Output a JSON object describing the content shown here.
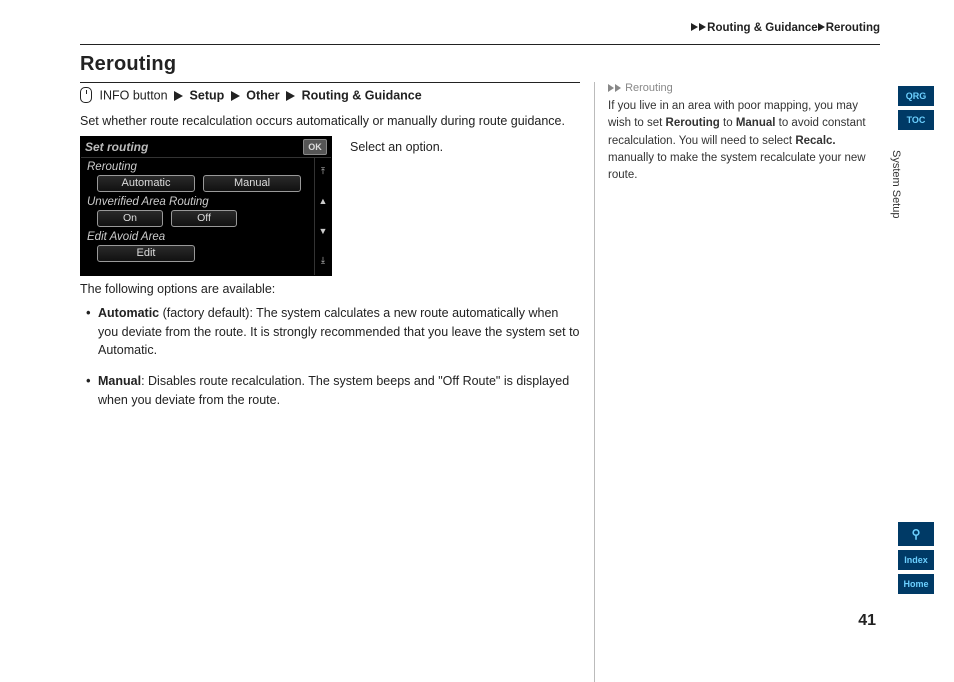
{
  "breadcrumb": {
    "seg1": "Routing & Guidance",
    "seg2": "Rerouting"
  },
  "title": "Rerouting",
  "navpath": {
    "prefix": "INFO button",
    "s1": "Setup",
    "s2": "Other",
    "s3": "Routing & Guidance"
  },
  "intro": "Set whether route recalculation occurs automatically or manually during route guidance.",
  "screen": {
    "title": "Set routing",
    "ok": "OK",
    "rerouting": "Rerouting",
    "auto": "Automatic",
    "manual": "Manual",
    "uar": "Unverified Area Routing",
    "on": "On",
    "off": "Off",
    "eaa": "Edit Avoid Area",
    "edit": "Edit"
  },
  "instruction": "Select an option.",
  "options_intro": "The following options are available:",
  "options": {
    "auto_label": "Automatic",
    "auto_text": " (factory default): The system calculates a new route automatically when you deviate from the route. It is strongly recommended that you leave the system set to Automatic.",
    "manual_label": "Manual",
    "manual_text": ": Disables route recalculation. The system beeps and \"Off Route\" is displayed when you deviate from the route."
  },
  "sidebar": {
    "title": "Rerouting",
    "p1a": "If you live in an area with poor mapping, you may wish to set ",
    "p1b": "Rerouting",
    "p1c": " to ",
    "p1d": "Manual",
    "p1e": " to avoid constant recalculation. You will need to select ",
    "p1f": "Recalc.",
    "p1g": " manually to make the system recalculate your new route."
  },
  "page_number": "41",
  "tabs": {
    "qrg": "QRG",
    "toc": "TOC",
    "search": "⚲",
    "index": "Index",
    "home": "Home"
  },
  "section_label": "System Setup"
}
